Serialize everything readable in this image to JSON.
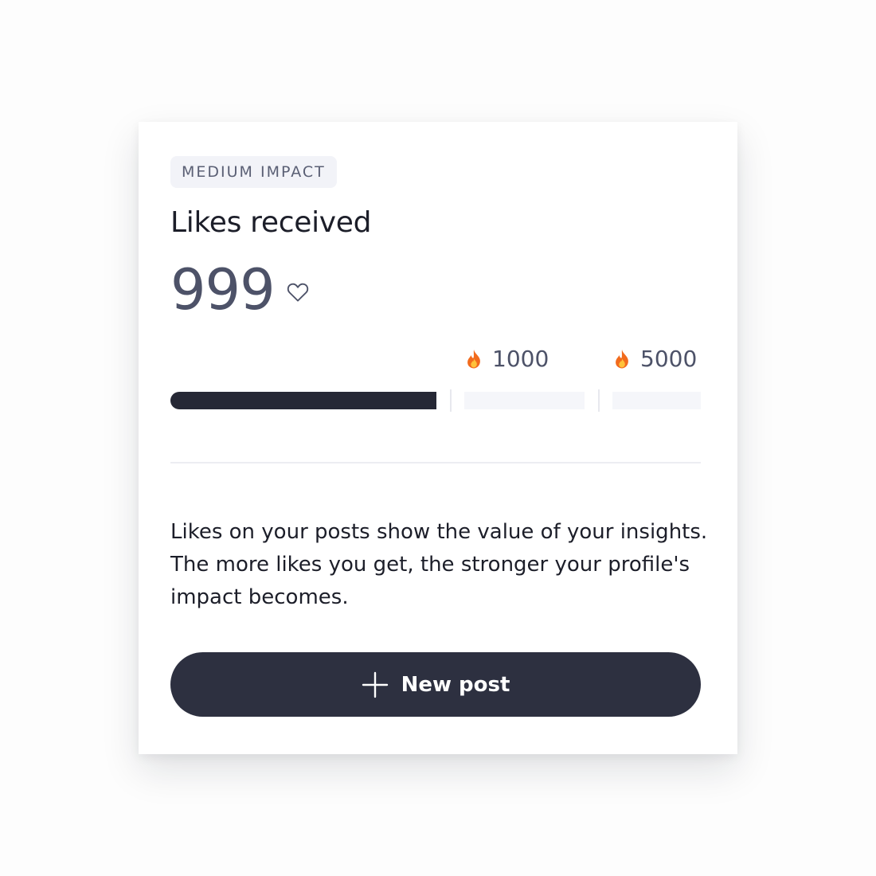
{
  "card": {
    "badge": "MEDIUM IMPACT",
    "title": "Likes received",
    "count": "999",
    "count_icon": "heart-icon",
    "progress": {
      "current": 999,
      "milestones": [
        {
          "icon": "flame-icon",
          "label": "1000"
        },
        {
          "icon": "flame-icon",
          "label": "5000"
        }
      ]
    },
    "description": "Likes on your posts show the value of your insights. The more likes you get, the stronger your profile's impact becomes.",
    "button": {
      "icon": "plus-icon",
      "label": "New post"
    },
    "colors": {
      "button_bg": "#2d3040",
      "progress_fill": "#262835",
      "badge_bg": "#f2f3f8",
      "flame": "#f26b1d"
    }
  }
}
